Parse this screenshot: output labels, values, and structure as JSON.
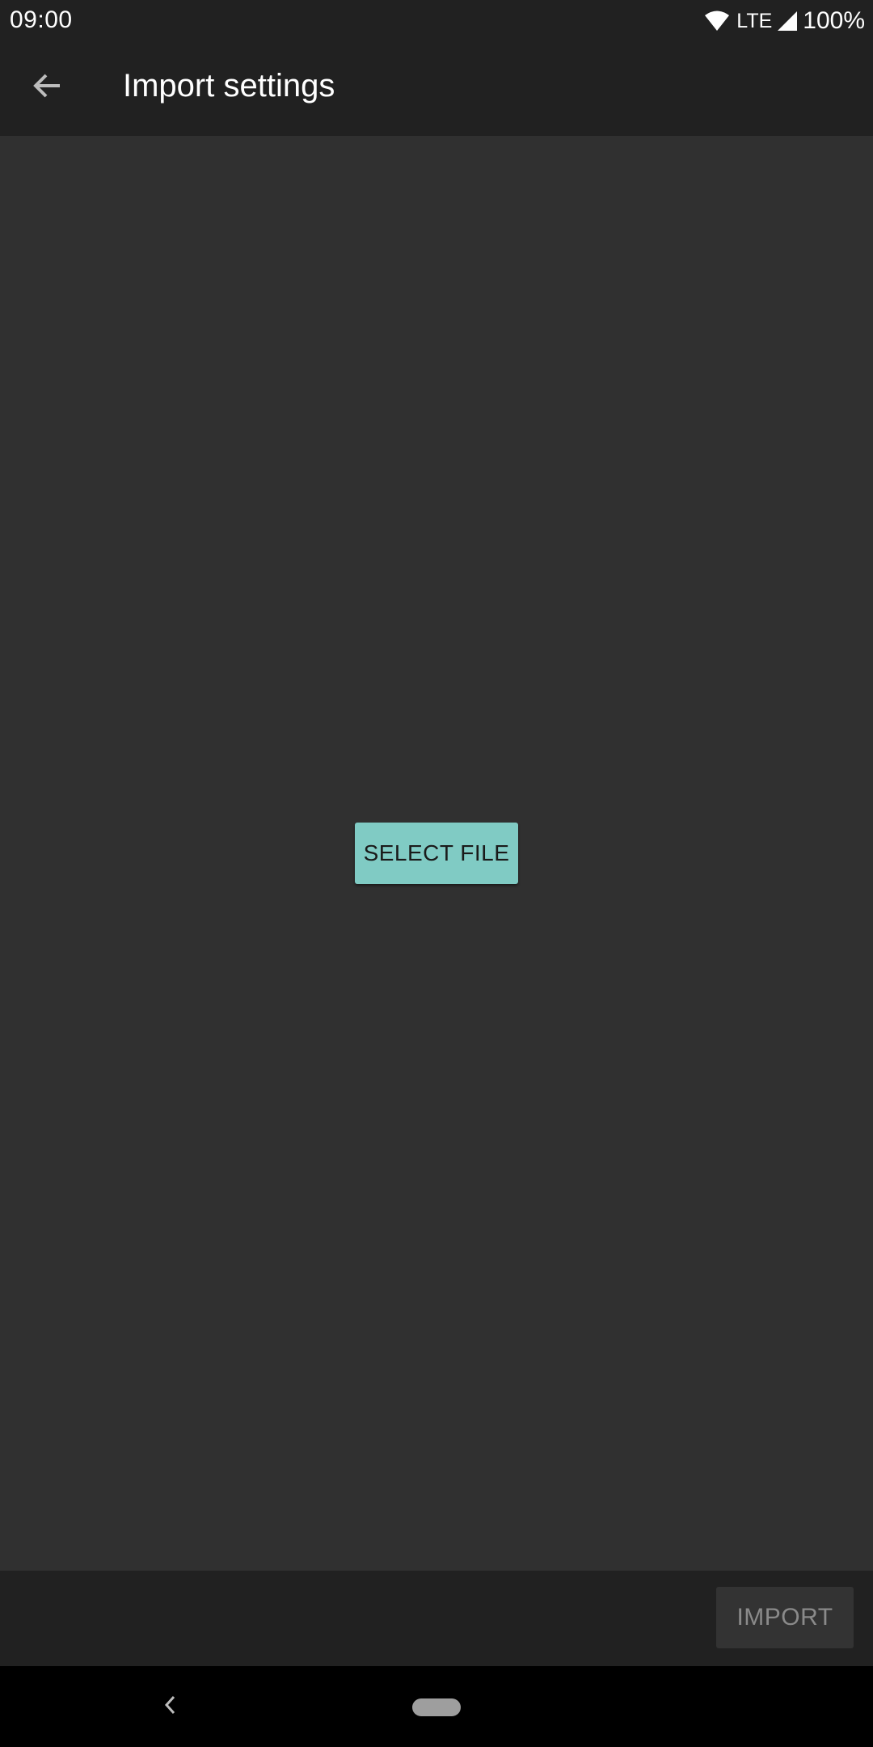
{
  "status_bar": {
    "time": "09:00",
    "network": "LTE",
    "battery": "100%",
    "icons": [
      "wifi-icon",
      "signal-icon"
    ]
  },
  "app_bar": {
    "title": "Import settings",
    "back_icon": "arrow-back-icon"
  },
  "content": {
    "select_file_label": "SELECT FILE",
    "select_file_color": "#80cbc4"
  },
  "bottom_bar": {
    "import_label": "IMPORT",
    "import_enabled": false
  },
  "nav_bar": {
    "back_icon": "chevron-left-icon",
    "home_icon": "home-pill-icon"
  },
  "colors": {
    "background": "#303030",
    "bars": "#212121",
    "accent": "#80cbc4"
  }
}
